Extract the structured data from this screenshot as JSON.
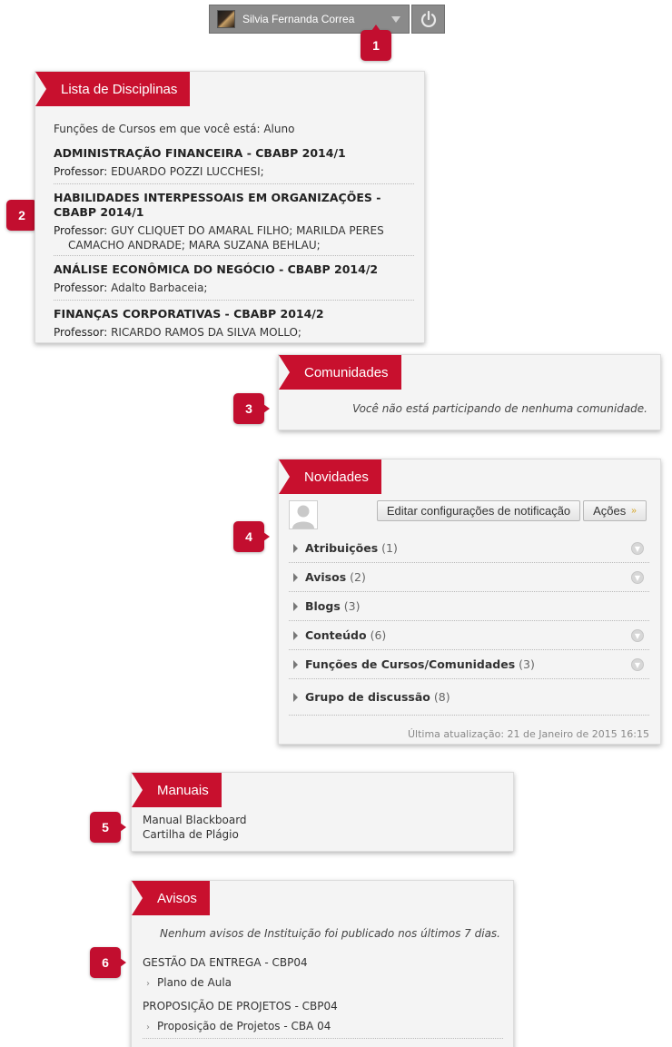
{
  "topbar": {
    "user_name": "Silvia Fernanda Correa"
  },
  "markers": [
    "1",
    "2",
    "3",
    "4",
    "5",
    "6"
  ],
  "disciplinas": {
    "title": "Lista de Disciplinas",
    "roles_text": "Funções de Cursos em que você está: Aluno",
    "professor_label": "Professor:",
    "courses": [
      {
        "name": "ADMINISTRAÇÃO FINANCEIRA - CBABP 2014/1",
        "professors_line1": "EDUARDO POZZI LUCCHESI;",
        "professors_line2": ""
      },
      {
        "name_line1": "HABILIDADES INTERPESSOAIS EM ORGANIZAÇÕES -",
        "name_line2": "CBABP 2014/1",
        "professors_line1": "GUY CLIQUET DO AMARAL FILHO;  MARILDA PERES",
        "professors_line2": "CAMACHO ANDRADE;  MARA SUZANA BEHLAU;"
      },
      {
        "name": "ANÁLISE ECONÔMICA DO NEGÓCIO - CBABP 2014/2",
        "professors_line1": "Adalto Barbaceia;",
        "professors_line2": ""
      },
      {
        "name": "FINANÇAS CORPORATIVAS - CBABP 2014/2",
        "professors_line1": "RICARDO RAMOS DA SILVA MOLLO;",
        "professors_line2": ""
      }
    ]
  },
  "comunidades": {
    "title": "Comunidades",
    "empty_message": "Você não está participando de nenhuma comunidade."
  },
  "novidades": {
    "title": "Novidades",
    "edit_notifications_label": "Editar configurações de notificação",
    "actions_label": "Ações",
    "items": [
      {
        "name": "Atribuições",
        "count": "(1)",
        "has_menu": true
      },
      {
        "name": "Avisos",
        "count": "(2)",
        "has_menu": true
      },
      {
        "name": "Blogs",
        "count": "(3)",
        "has_menu": false
      },
      {
        "name": "Conteúdo",
        "count": "(6)",
        "has_menu": true
      },
      {
        "name": "Funções de Cursos/Comunidades",
        "count": "(3)",
        "has_menu": true
      },
      {
        "name": "Grupo de discussão",
        "count": "(8)",
        "has_menu": false
      }
    ],
    "last_update": "Última atualização: 21 de Janeiro de 2015 16:15"
  },
  "manuais": {
    "title": "Manuais",
    "links": [
      "Manual Blackboard",
      "Cartilha de Plágio"
    ]
  },
  "avisos": {
    "title": "Avisos",
    "empty_message": "Nenhum avisos de Instituição foi publicado nos últimos 7 dias.",
    "courses": [
      {
        "name": "GESTÃO DA ENTREGA - CBP04",
        "item": "Plano de Aula"
      },
      {
        "name": "PROPOSIÇÃO DE PROJETOS - CBP04",
        "item": "Proposição de Projetos - CBA 04"
      }
    ]
  }
}
